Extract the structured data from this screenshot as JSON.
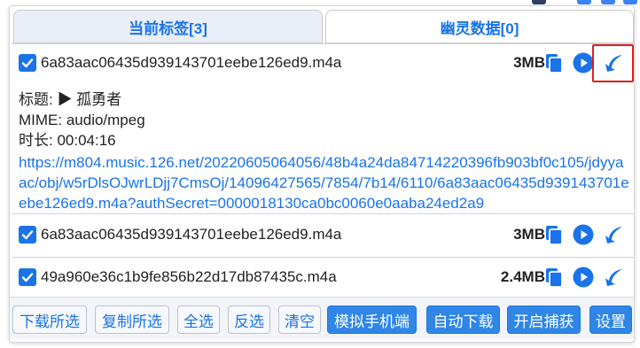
{
  "colors": {
    "accent": "#1a73e8",
    "button_blue": "#2f86e6",
    "highlight": "#e11d1d"
  },
  "tabs": [
    {
      "label": "当前标签[3]",
      "active": true
    },
    {
      "label": "幽灵数据[0]",
      "active": false
    }
  ],
  "items": [
    {
      "checked": true,
      "filename": "6a83aac06435d939143701eebe126ed9.m4a",
      "size": "3MB",
      "icons": [
        "copy-icon",
        "play-icon",
        "download-icon"
      ],
      "details": {
        "title_line": "标题: ▶ 孤勇者",
        "mime_line": "MIME: audio/mpeg",
        "duration_line": "时长: 00:04:16",
        "url": "https://m804.music.126.net/20220605064056/48b4a24da84714220396fb903bf0c105/jdyyaac/obj/w5rDlsOJwrLDjj7CmsOj/14096427565/7854/7b14/6110/6a83aac06435d939143701eebe126ed9.m4a?authSecret=0000018130ca0bc0060e0aaba24ed2a9"
      }
    },
    {
      "checked": true,
      "filename": "6a83aac06435d939143701eebe126ed9.m4a",
      "size": "3MB",
      "icons": [
        "copy-icon",
        "play-icon",
        "download-icon"
      ]
    },
    {
      "checked": true,
      "filename": "49a960e36c1b9fe856b22d17db87435c.m4a",
      "size": "2.4MB",
      "icons": [
        "copy-icon",
        "play-icon",
        "download-icon"
      ]
    }
  ],
  "footer": {
    "buttons": [
      {
        "label": "下载所选",
        "style": "light"
      },
      {
        "label": "复制所选",
        "style": "light"
      },
      {
        "label": "全选",
        "style": "light"
      },
      {
        "label": "反选",
        "style": "light"
      },
      {
        "label": "清空",
        "style": "light"
      },
      {
        "label": "模拟手机端",
        "style": "blue"
      },
      {
        "label": "自动下载",
        "style": "blue"
      },
      {
        "label": "开启捕获",
        "style": "blue"
      },
      {
        "label": "设置",
        "style": "blue"
      }
    ]
  }
}
